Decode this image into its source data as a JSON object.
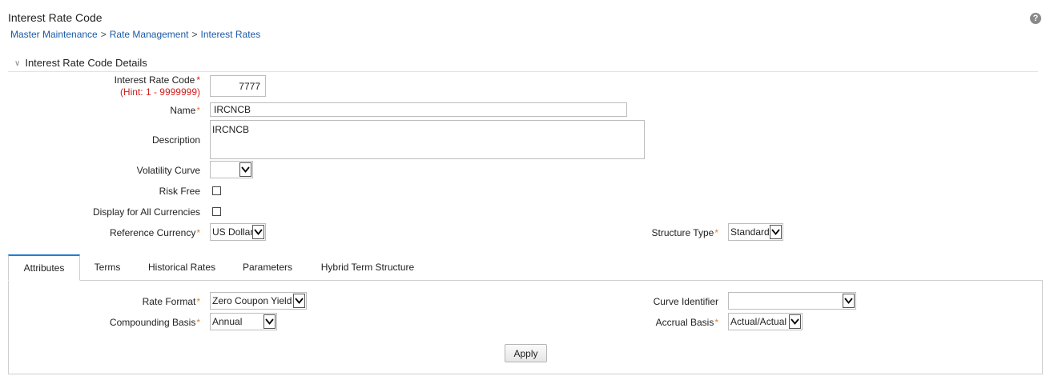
{
  "header": {
    "title": "Interest Rate Code",
    "breadcrumb": [
      "Master Maintenance",
      "Rate Management",
      "Interest Rates"
    ],
    "breadcrumb_separator": ">",
    "help_icon": "question-circle-icon"
  },
  "section": {
    "title": "Interest Rate Code Details"
  },
  "form": {
    "interest_rate_code": {
      "label": "Interest Rate Code",
      "required_marker": "*",
      "hint": "(Hint: 1 - 9999999)",
      "value": "7777"
    },
    "name": {
      "label": "Name",
      "required_marker": "*",
      "value": "IRCNCB"
    },
    "description": {
      "label": "Description",
      "value": "IRCNCB"
    },
    "volatility_curve": {
      "label": "Volatility Curve",
      "value": ""
    },
    "risk_free": {
      "label": "Risk Free",
      "checked": false
    },
    "display_all_currencies": {
      "label": "Display for All Currencies",
      "checked": false
    },
    "reference_currency": {
      "label": "Reference Currency",
      "required_marker": "*",
      "value": "US Dollar"
    },
    "structure_type": {
      "label": "Structure Type",
      "required_marker": "*",
      "value": "Standard"
    }
  },
  "tabs": [
    {
      "label": "Attributes",
      "active": true
    },
    {
      "label": "Terms",
      "active": false
    },
    {
      "label": "Historical Rates",
      "active": false
    },
    {
      "label": "Parameters",
      "active": false
    },
    {
      "label": "Hybrid Term Structure",
      "active": false
    }
  ],
  "attributes": {
    "rate_format": {
      "label": "Rate Format",
      "required_marker": "*",
      "value": "Zero Coupon Yield"
    },
    "compounding_basis": {
      "label": "Compounding Basis",
      "required_marker": "*",
      "value": "Annual"
    },
    "curve_identifier": {
      "label": "Curve Identifier",
      "value": ""
    },
    "accrual_basis": {
      "label": "Accrual Basis",
      "required_marker": "*",
      "value": "Actual/Actual"
    },
    "apply_label": "Apply"
  },
  "colors": {
    "link": "#1b5aa6",
    "required": "#e08030",
    "hint": "#d02020",
    "active_tab_accent": "#1b7fd4"
  }
}
